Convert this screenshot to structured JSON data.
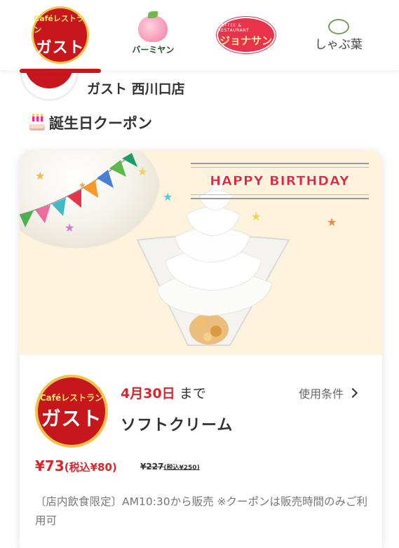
{
  "brands": [
    {
      "id": "gusto",
      "logo_top": "Caféレストラン",
      "logo_main": "ガスト",
      "active": true
    },
    {
      "id": "bamiyan",
      "logo_main": "バーミヤン"
    },
    {
      "id": "jonathan",
      "logo_top": "COFFEE & RESTAURANT",
      "logo_main": "ジョナサン"
    },
    {
      "id": "shabuyo",
      "logo_main": "しゃぶ葉"
    }
  ],
  "store": {
    "name": "ガスト 西川口店"
  },
  "section": {
    "title": "誕生日クーポン",
    "icon": "birthday-cake-icon"
  },
  "banner": {
    "text": "HAPPY BIRTHDAY"
  },
  "coupon": {
    "logo_top": "Caféレストラン",
    "logo_main": "ガスト",
    "expiry_date": "4月30日",
    "expiry_suffix": "まで",
    "terms_label": "使用条件",
    "product": "ソフトクリーム",
    "price": "¥73",
    "price_tax": "(税込¥80)",
    "original_price": "¥227",
    "original_price_tax": "(税込¥250)",
    "note": "〔店内飲食限定〕AM10:30から販売 ※クーポンは販売時間のみご利用可"
  },
  "colors": {
    "brand_red": "#c8161d",
    "price_red": "#d8262d",
    "banner_bg": "#fdf3dc"
  }
}
